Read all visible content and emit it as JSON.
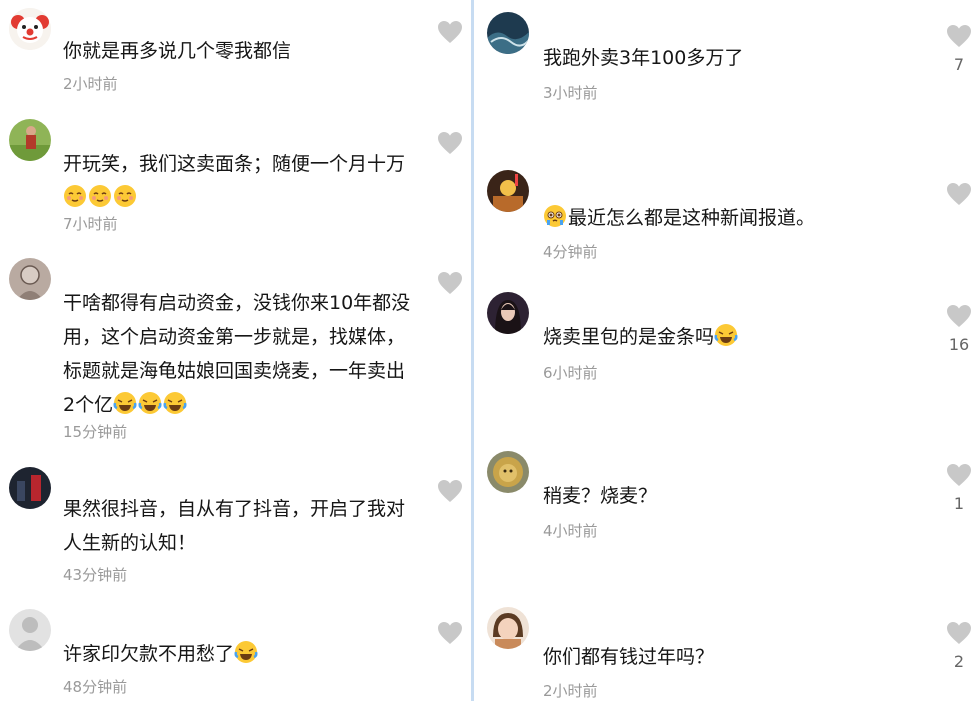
{
  "left_column": [
    {
      "avatar": "clown-avatar",
      "text_lines": [
        "你就是再多说几个零我都信"
      ],
      "time": "2小时前",
      "likes": ""
    },
    {
      "avatar": "field-avatar",
      "text_lines": [
        "开玩笑，我们这卖面条；随便一个月十万"
      ],
      "emoji_line": [
        "blush-emoji",
        "blush-emoji",
        "blush-emoji"
      ],
      "time": "7小时前",
      "likes": ""
    },
    {
      "avatar": "sketch-avatar",
      "text_lines": [
        "干啥都得有启动资金，没钱你来10年都没",
        "用，这个启动资金第一步就是，找媒体，",
        "标题就是海龟姑娘回国卖烧麦，一年卖出",
        "2个亿"
      ],
      "time": "15分钟前",
      "likes": ""
    },
    {
      "avatar": "dark-avatar",
      "text_lines": [
        "果然很抖音，自从有了抖音，开启了我对",
        "人生新的认知！"
      ],
      "time": "43分钟前",
      "likes": ""
    },
    {
      "avatar": "default-avatar",
      "text_lines": [
        "许家印欠款不用愁了"
      ],
      "time": "48分钟前",
      "likes": ""
    }
  ],
  "right_column": [
    {
      "avatar": "ocean-avatar",
      "text_lines": [
        "我跑外卖3年100多万了"
      ],
      "time": "3小时前",
      "likes": "7"
    },
    {
      "avatar": "pudding-avatar",
      "text_lines": [
        "最近怎么都是这种新闻报道。"
      ],
      "time": "4分钟前",
      "likes": ""
    },
    {
      "avatar": "girl-avatar",
      "text_lines": [
        "烧卖里包的是金条吗"
      ],
      "time": "6小时前",
      "likes": "16"
    },
    {
      "avatar": "lion-avatar",
      "text_lines": [
        "稍麦？烧麦？"
      ],
      "time": "4小时前",
      "likes": "1"
    },
    {
      "avatar": "child-avatar",
      "text_lines": [
        "你们都有钱过年吗？"
      ],
      "time": "2小时前",
      "likes": "2"
    }
  ],
  "colors": {
    "time": "#9a9a9a",
    "heart": "#c8c8c8",
    "divider": "#c7dcf2"
  }
}
